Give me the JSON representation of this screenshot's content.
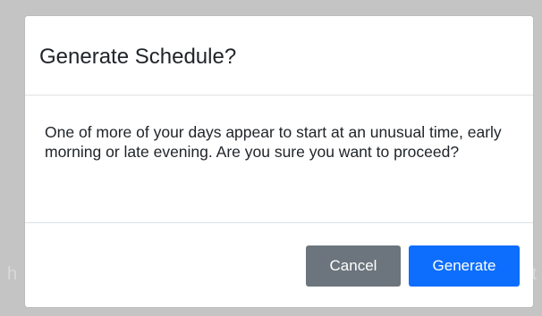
{
  "backdrop": {
    "left_fragment": "h",
    "right_fragment": "t"
  },
  "modal": {
    "title": "Generate Schedule?",
    "message": "One of more of your days appear to start at an unusual time, early morning or late evening. Are you sure you want to proceed?",
    "buttons": {
      "cancel_label": "Cancel",
      "generate_label": "Generate"
    }
  },
  "colors": {
    "primary": "#0d6efd",
    "secondary": "#6c757d",
    "overlay": "#c4c4c4"
  }
}
